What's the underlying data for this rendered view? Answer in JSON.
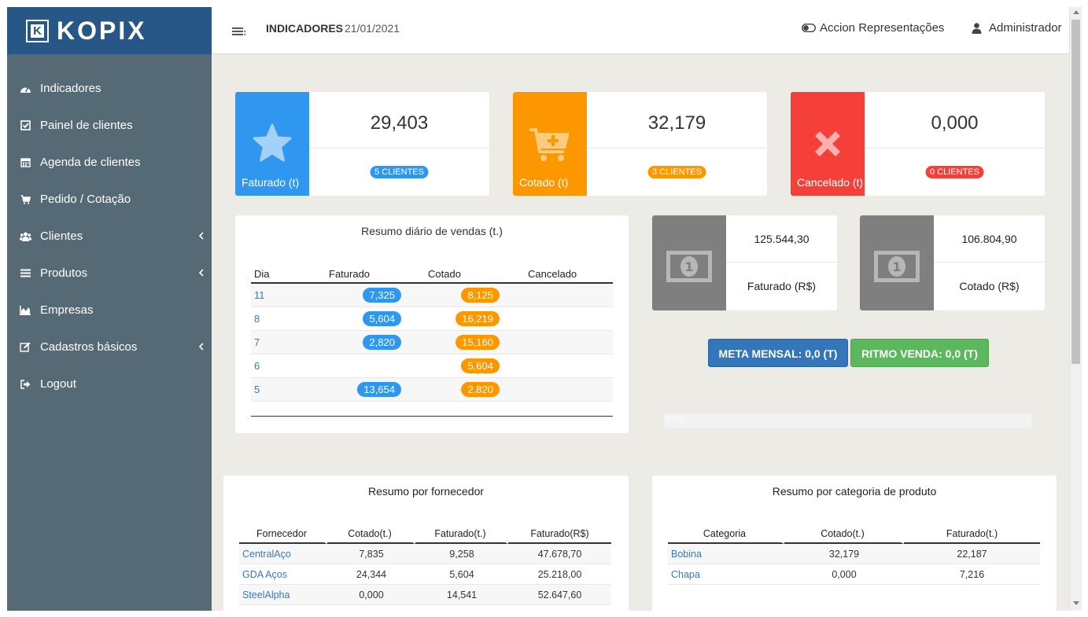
{
  "brand": {
    "name": "KOPIX",
    "mark": "K"
  },
  "colors": {
    "blue": "#2f97ef",
    "orange": "#fc9700",
    "red": "#f5403a",
    "gray": "#7f7f7f",
    "sidebar": "#556a75",
    "logo_bg": "#275786",
    "meta": "#3376b9",
    "ritmo": "#5cb85c"
  },
  "sidebar": {
    "items": [
      {
        "label": "Indicadores",
        "icon": "dashboard-icon"
      },
      {
        "label": "Painel de clientes",
        "icon": "check-square-icon"
      },
      {
        "label": "Agenda de clientes",
        "icon": "calendar-icon"
      },
      {
        "label": "Pedido / Cotação",
        "icon": "cart-icon"
      },
      {
        "label": "Clientes",
        "icon": "users-icon"
      },
      {
        "label": "Produtos",
        "icon": "list-icon"
      },
      {
        "label": "Empresas",
        "icon": "area-chart-icon"
      },
      {
        "label": "Cadastros básicos",
        "icon": "edit-icon"
      },
      {
        "label": "Logout",
        "icon": "sign-out-icon"
      }
    ]
  },
  "header": {
    "title": "INDICADORES",
    "date": "21/01/2021",
    "company": "Accion Representações",
    "user": "Administrador"
  },
  "stats": [
    {
      "label": "Faturado (t)",
      "value": "29,403",
      "badge": "5 CLIENTES",
      "icon": "star-icon"
    },
    {
      "label": "Cotado (t)",
      "value": "32,179",
      "badge": "3 CLIENTES",
      "icon": "cart-plus-icon"
    },
    {
      "label": "Cancelado (t)",
      "value": "0,000",
      "badge": "0 CLIENTES",
      "icon": "x-icon"
    }
  ],
  "daily": {
    "title": "Resumo diário de vendas (t.)",
    "headers": [
      "Dia",
      "Faturado",
      "Cotado",
      "Cancelado"
    ],
    "rows": [
      {
        "dia": "11",
        "faturado": "7,325",
        "cotado": "8,125",
        "cancelado": ""
      },
      {
        "dia": "8",
        "faturado": "5,604",
        "cotado": "16,219",
        "cancelado": ""
      },
      {
        "dia": "7",
        "faturado": "2,820",
        "cotado": "15,160",
        "cancelado": ""
      },
      {
        "dia": "6",
        "faturado": "",
        "cotado": "5,604",
        "cancelado": ""
      },
      {
        "dia": "5",
        "faturado": "13,654",
        "cotado": "2,820",
        "cancelado": ""
      }
    ]
  },
  "money": [
    {
      "value": "125.544,30",
      "label": "Faturado (R$)",
      "icon": "money-icon"
    },
    {
      "value": "106.804,90",
      "label": "Cotado (R$)",
      "icon": "money-icon"
    }
  ],
  "meta": {
    "meta_label": "META MENSAL: 0,0 (T)",
    "ritmo_label": "RITMO VENDA: 0,0 (T)"
  },
  "progress": {
    "text": "0.0%",
    "value": 0
  },
  "fornecedor": {
    "title": "Resumo por fornecedor",
    "headers": [
      "Fornecedor",
      "Cotado(t.)",
      "Faturado(t.)",
      "Faturado(R$)"
    ],
    "rows": [
      [
        "CentralAço",
        "7,835",
        "9,258",
        "47.678,70"
      ],
      [
        "GDA Aços",
        "24,344",
        "5,604",
        "25.218,00"
      ],
      [
        "SteelAlpha",
        "0,000",
        "14,541",
        "52.647,60"
      ]
    ]
  },
  "categoria": {
    "title": "Resumo por categoria de produto",
    "headers": [
      "Categoria",
      "Cotado(t.)",
      "Faturado(t.)"
    ],
    "rows": [
      [
        "Bobina",
        "32,179",
        "22,187"
      ],
      [
        "Chapa",
        "0,000",
        "7,216"
      ]
    ]
  }
}
